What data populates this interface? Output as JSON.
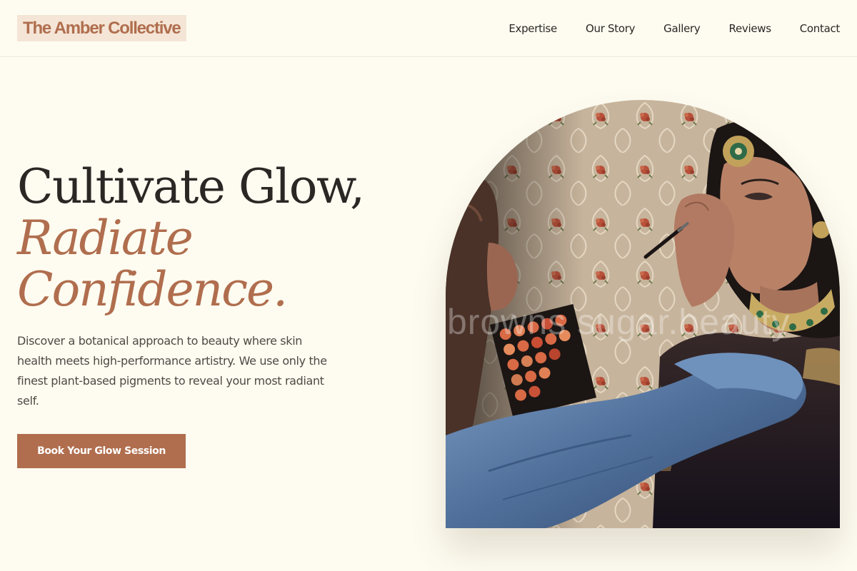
{
  "brand": {
    "name": "The Amber Collective",
    "accent_color": "#b06e4e",
    "background_color": "#fefcf1"
  },
  "nav": {
    "items": [
      "Expertise",
      "Our Story",
      "Gallery",
      "Reviews",
      "Contact"
    ]
  },
  "hero": {
    "title_line1": "Cultivate Glow,",
    "title_line2": "Radiate",
    "title_line3": "Confidence.",
    "description": "Discover a botanical approach to beauty where skin health meets high-performance artistry. We use only the finest plant-based pigments to reveal your most radiant self.",
    "cta_label": "Book Your Glow Session"
  },
  "hero_image": {
    "watermark": "browns sugar.beauty"
  }
}
